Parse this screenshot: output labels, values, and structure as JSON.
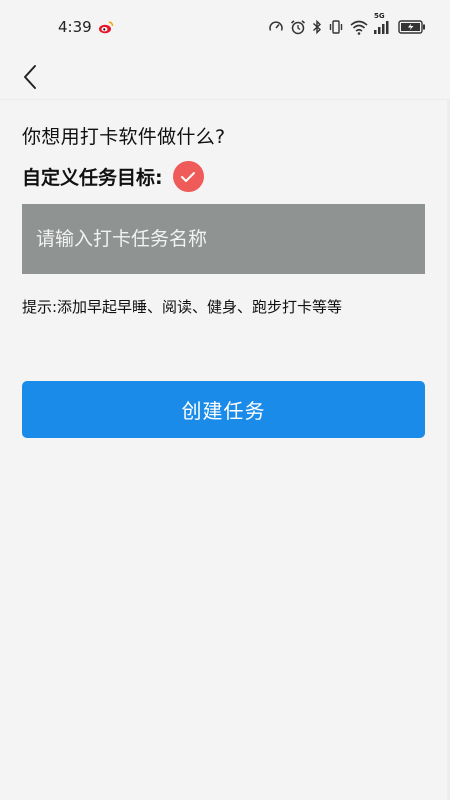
{
  "status_bar": {
    "time": "4:39",
    "network_label": "5G",
    "icons": [
      "weibo-icon",
      "speedometer-icon",
      "alarm-icon",
      "bluetooth-icon",
      "vibrate-icon",
      "wifi-icon",
      "signal-icon",
      "battery-charging-icon"
    ]
  },
  "header": {
    "back_icon": "chevron-left-icon"
  },
  "main": {
    "question": "你想用打卡软件做什么?",
    "custom_label": "自定义任务目标:",
    "check_icon": "checkmark-icon",
    "task_input": {
      "placeholder": "请输入打卡任务名称",
      "value": ""
    },
    "hint": "提示:添加早起早睡、阅读、健身、跑步打卡等等",
    "create_button": "创建任务"
  },
  "colors": {
    "background": "#f4f4f4",
    "accent": "#1a8be8",
    "check_badge": "#ee5b58",
    "input_bg": "#8f9493"
  }
}
